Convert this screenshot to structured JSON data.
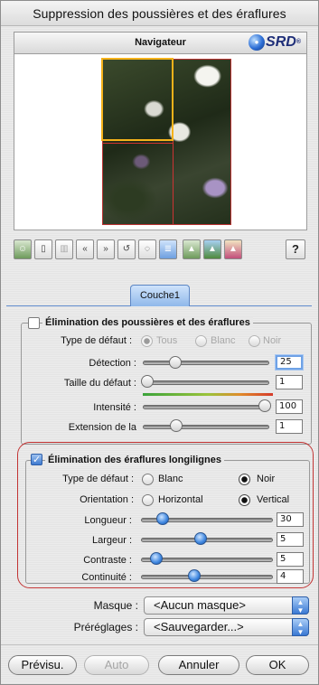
{
  "window": {
    "title": "Suppression des poussières et des éraflures"
  },
  "navigator": {
    "title": "Navigateur",
    "logo_text": "SRD",
    "logo_mark": "®"
  },
  "toolbar": {
    "icons": [
      "portrait-icon",
      "new-document-icon",
      "trash-icon",
      "rewind-icon",
      "fast-forward-icon",
      "undo-arrow-icon",
      "lasso-icon",
      "list-icon",
      "landscape-icon",
      "landscape-icon-2",
      "landscape-icon-3"
    ],
    "help_label": "?"
  },
  "tab": {
    "label": "Couche1"
  },
  "dust": {
    "title": "Élimination des poussières et des éraflures",
    "checked": false,
    "defect_type_label": "Type de défaut :",
    "options": [
      "Tous",
      "Blanc",
      "Noir"
    ],
    "selected": "Tous",
    "detection_label": "Détection :",
    "detection_value": "25",
    "size_label": "Taille du défaut :",
    "size_value": "1",
    "intensity_label": "Intensité :",
    "intensity_value": "100",
    "extension_label": "Extension de la",
    "extension_value": "1"
  },
  "scratch": {
    "title": "Élimination des éraflures longilignes",
    "checked": true,
    "defect_type_label": "Type de défaut :",
    "defect_options": [
      "Blanc",
      "Noir"
    ],
    "defect_selected": "Noir",
    "orientation_label": "Orientation :",
    "orientation_options": [
      "Horizontal",
      "Vertical"
    ],
    "orientation_selected": "Vertical",
    "length_label": "Longueur :",
    "length_value": "30",
    "width_label": "Largeur :",
    "width_value": "5",
    "contrast_label": "Contraste :",
    "contrast_value": "5",
    "continuity_label": "Continuité :",
    "continuity_value": "4"
  },
  "mask": {
    "label": "Masque :",
    "value": "<Aucun masque>"
  },
  "presets": {
    "label": "Préréglages :",
    "value": "<Sauvegarder...>"
  },
  "buttons": {
    "preview": "Prévisu.",
    "auto": "Auto",
    "cancel": "Annuler",
    "ok": "OK"
  },
  "colors": {
    "accent": "#3a79d3",
    "highlight": "#c23434",
    "viewbox": "#f5b21a"
  }
}
